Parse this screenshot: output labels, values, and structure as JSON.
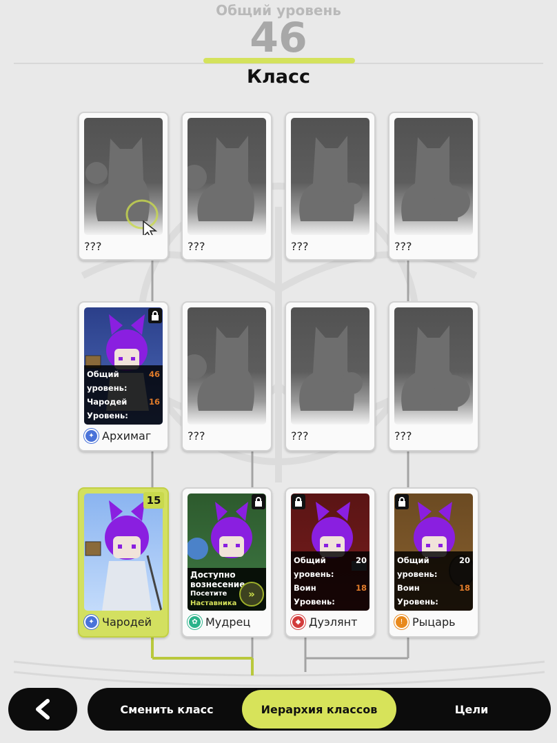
{
  "header": {
    "level_caption": "Общий уровень",
    "level_value": "46",
    "title": "Класс"
  },
  "cards": {
    "r1c1": {
      "name": "???"
    },
    "r1c2": {
      "name": "???"
    },
    "r1c3": {
      "name": "???"
    },
    "r1c4": {
      "name": "???"
    },
    "archmage": {
      "name": "Архимаг",
      "req_total_label": "Общий уровень:",
      "req_total_value": "46",
      "req_class_label": "Чародей Уровень:",
      "req_class_value": "16"
    },
    "r2c2": {
      "name": "???"
    },
    "r2c3": {
      "name": "???"
    },
    "r2c4": {
      "name": "???"
    },
    "sorcerer": {
      "name": "Чародей",
      "level": "15"
    },
    "sage": {
      "name": "Мудрец",
      "asc_line1": "Доступно",
      "asc_line2": "вознесение",
      "asc_line3": "Посетите",
      "asc_line4": "Наставника класса"
    },
    "duelist": {
      "name": "Дуэлянт",
      "req_total_label": "Общий уровень:",
      "req_total_value": "20",
      "req_class_label": "Воин Уровень:",
      "req_class_value": "18"
    },
    "knight": {
      "name": "Рыцарь",
      "req_total_label": "Общий уровень:",
      "req_total_value": "20",
      "req_class_label": "Воин Уровень:",
      "req_class_value": "18"
    }
  },
  "nav": {
    "tabs": [
      "Сменить класс",
      "Иерархия классов",
      "Цели"
    ],
    "active_tab": "Иерархия классов"
  },
  "colors": {
    "accent": "#d7e35a",
    "requirement_value": "#e07b2a",
    "hair": "#8a1fe0"
  },
  "icons": [
    "back-arrow-icon",
    "lock-icon",
    "mage-class-icon",
    "sage-class-icon",
    "warrior-class-icon",
    "knight-class-icon",
    "ascension-arrow-icon"
  ]
}
